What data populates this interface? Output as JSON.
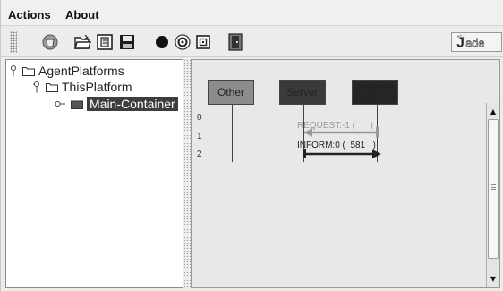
{
  "menu": {
    "actions": "Actions",
    "about": "About"
  },
  "toolbar": {
    "buttons": [
      "delete-icon",
      "open-folder-icon",
      "open-file-icon",
      "save-icon",
      "black-circle-icon",
      "swirl-icon",
      "square-target-icon",
      "exit-door-icon"
    ],
    "logo_text": "Jade"
  },
  "tree": {
    "root": "AgentPlatforms",
    "platform": "ThisPlatform",
    "container": "Main-Container"
  },
  "sniffer": {
    "agents": [
      {
        "name": "Other",
        "color": "#8c8c8c"
      },
      {
        "name": "Server",
        "color": "#3a3a3a"
      },
      {
        "name": "testowe zapytanie",
        "color": "#262626"
      }
    ],
    "rows": [
      "0",
      "1",
      "2"
    ],
    "messages": [
      {
        "label": "REQUEST:-1 (      )",
        "from": "testowe zapytanie",
        "to": "Server",
        "color": "#999999"
      },
      {
        "label": "INFORM:0 (  581   )",
        "from": "Server",
        "to": "testowe zapytanie",
        "color": "#222222"
      }
    ]
  }
}
